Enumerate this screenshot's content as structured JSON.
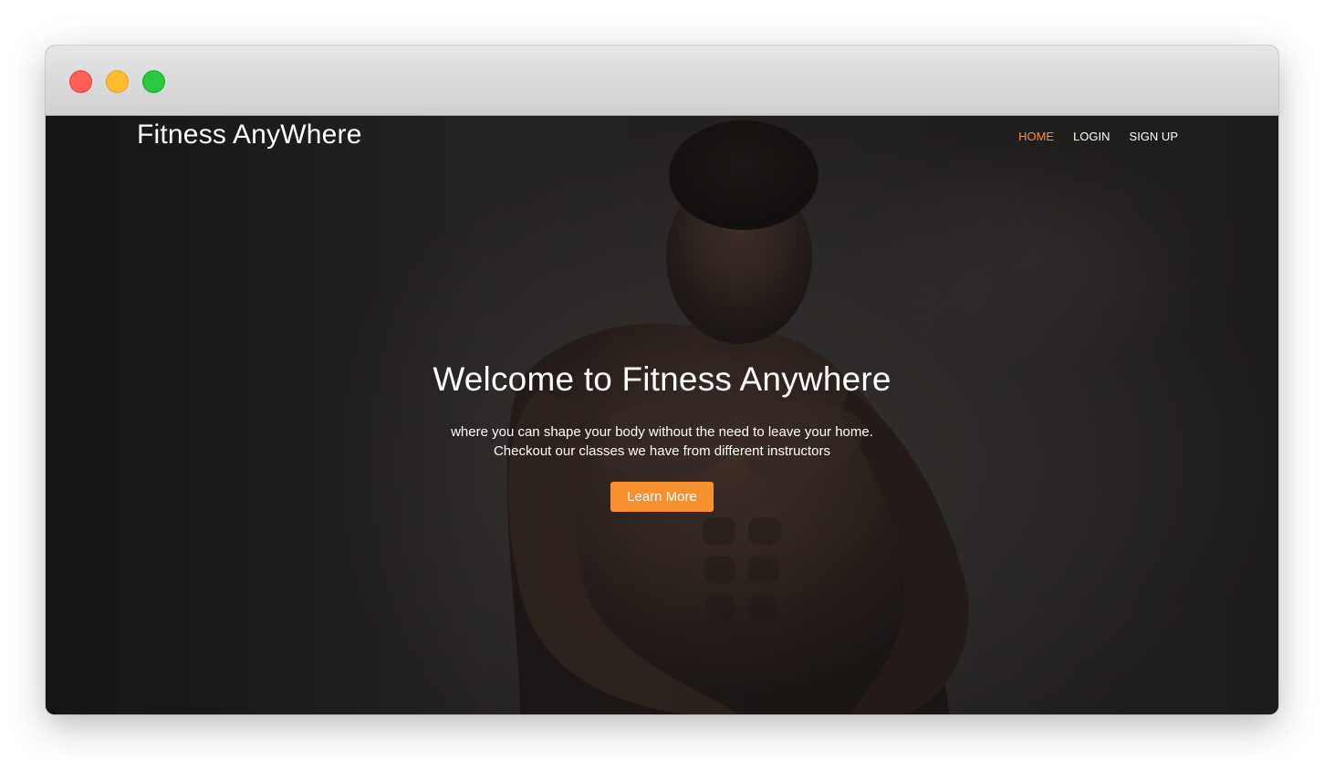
{
  "window": {
    "controls": [
      "close-button",
      "minimize-button",
      "maximize-button"
    ]
  },
  "site": {
    "brand": "Fitness AnyWhere",
    "nav": [
      {
        "label": "HOME",
        "active": true
      },
      {
        "label": "LOGIN",
        "active": false
      },
      {
        "label": "SIGN UP",
        "active": false
      }
    ]
  },
  "hero": {
    "title": "Welcome to Fitness Anywhere",
    "subtitle_line1": "where you can shape your body without the need to leave your home.",
    "subtitle_line2": "Checkout our classes we have from different instructors",
    "cta_label": "Learn More",
    "image": "athlete-photo"
  },
  "colors": {
    "accent": "#f7902f",
    "nav_active": "#ff8b2c",
    "text": "#ffffff",
    "overlay": "#2b2928"
  }
}
